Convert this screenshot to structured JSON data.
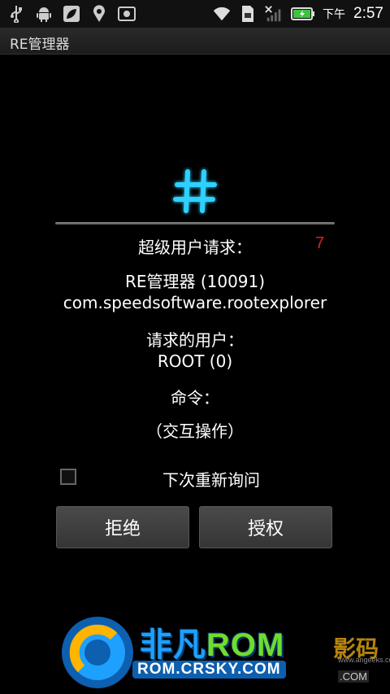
{
  "status_bar": {
    "ampm": "下午",
    "time": "2:57",
    "icons_left": [
      "usb-icon",
      "android-icon",
      "leaf-icon",
      "location-icon",
      "screenshot-icon"
    ],
    "icons_right": [
      "wifi-icon",
      "sim-icon",
      "signal-icon",
      "battery-icon"
    ]
  },
  "app": {
    "title": "RE管理器"
  },
  "dialog": {
    "heading": "超级用户请求：",
    "countdown": "7",
    "app_name": "RE管理器 (10091)",
    "package": "com.speedsoftware.rootexplorer",
    "user_label": "请求的用户：",
    "user_value": "ROOT (0)",
    "command_label": "命令：",
    "command_value": "（交互操作）",
    "remember_label": "下次重新询问",
    "remember_checked": false,
    "deny_label": "拒绝",
    "allow_label": "授权"
  },
  "watermark": {
    "brand_cn": "非凡",
    "brand_en": "ROM",
    "url": "ROM.CRSKY.COM",
    "right_text": "影码",
    "right_small": "www.angeeks.com",
    "right_small2": ".COM"
  },
  "colors": {
    "accent_cyan": "#2fd0ff",
    "countdown_red": "#e02020",
    "battery_green": "#3ec23e"
  }
}
